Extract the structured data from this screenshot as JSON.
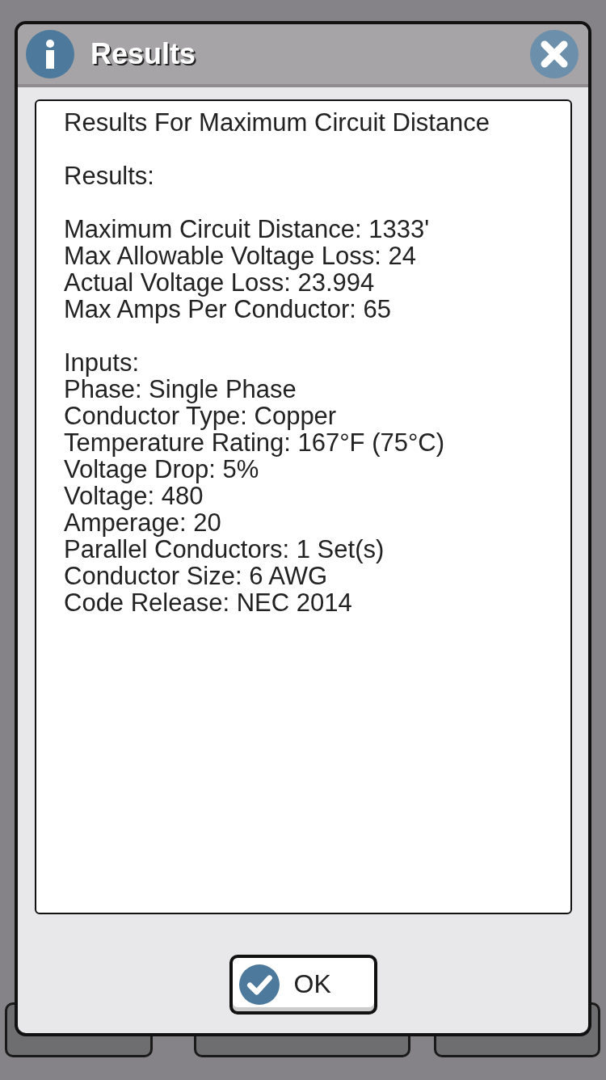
{
  "dialog": {
    "title": "Results",
    "button": "OK"
  },
  "report": {
    "title": "Results For Maximum Circuit Distance",
    "sections": [
      {
        "heading": "Results:",
        "kind": "spaced",
        "lines": [
          "Maximum Circuit Distance: 1333'",
          "Max Allowable Voltage Loss: 24",
          "Actual Voltage Loss: 23.994",
          "Max Amps Per Conductor: 65"
        ]
      },
      {
        "heading": "Inputs:",
        "kind": "compact",
        "lines": [
          "Phase: Single Phase",
          "Conductor Type: Copper",
          "Temperature Rating: 167°F (75°C)",
          "Voltage Drop: 5%",
          "Voltage: 480",
          "Amperage: 20",
          "Parallel Conductors: 1 Set(s)",
          "Conductor Size: 6 AWG",
          "Code Release: NEC 2014"
        ]
      }
    ]
  }
}
